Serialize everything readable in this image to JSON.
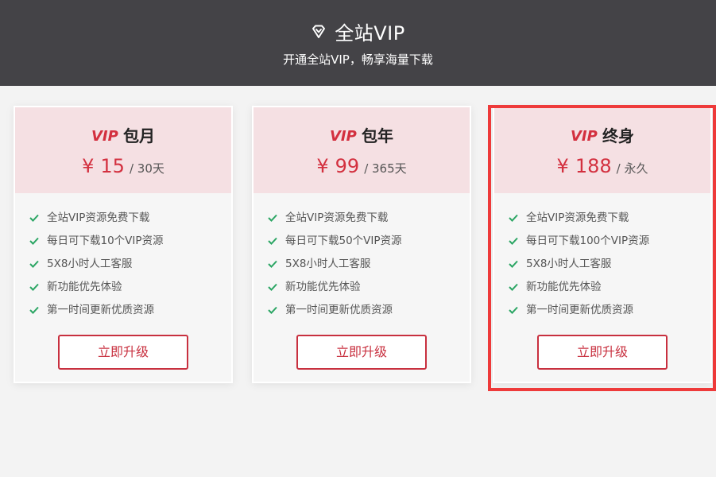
{
  "header": {
    "title": "全站VIP",
    "subtitle": "开通全站VIP，畅享海量下载",
    "icon": "diamond-icon"
  },
  "colors": {
    "header_bg": "#444347",
    "card_top_bg": "#f5e0e3",
    "accent_red": "#d3303f",
    "check_green": "#2aa563",
    "highlight_border": "#ee3a3a"
  },
  "plans": [
    {
      "vip_logo": "VIP",
      "name": "包月",
      "currency": "¥",
      "price": "15",
      "period": "/ 30天",
      "features": [
        "全站VIP资源免费下载",
        "每日可下载10个VIP资源",
        "5X8小时人工客服",
        "新功能优先体验",
        "第一时间更新优质资源"
      ],
      "button": "立即升级"
    },
    {
      "vip_logo": "VIP",
      "name": "包年",
      "currency": "¥",
      "price": "99",
      "period": "/ 365天",
      "features": [
        "全站VIP资源免费下载",
        "每日可下载50个VIP资源",
        "5X8小时人工客服",
        "新功能优先体验",
        "第一时间更新优质资源"
      ],
      "button": "立即升级"
    },
    {
      "vip_logo": "VIP",
      "name": "终身",
      "currency": "¥",
      "price": "188",
      "period": "/ 永久",
      "features": [
        "全站VIP资源免费下载",
        "每日可下载100个VIP资源",
        "5X8小时人工客服",
        "新功能优先体验",
        "第一时间更新优质资源"
      ],
      "button": "立即升级"
    }
  ]
}
